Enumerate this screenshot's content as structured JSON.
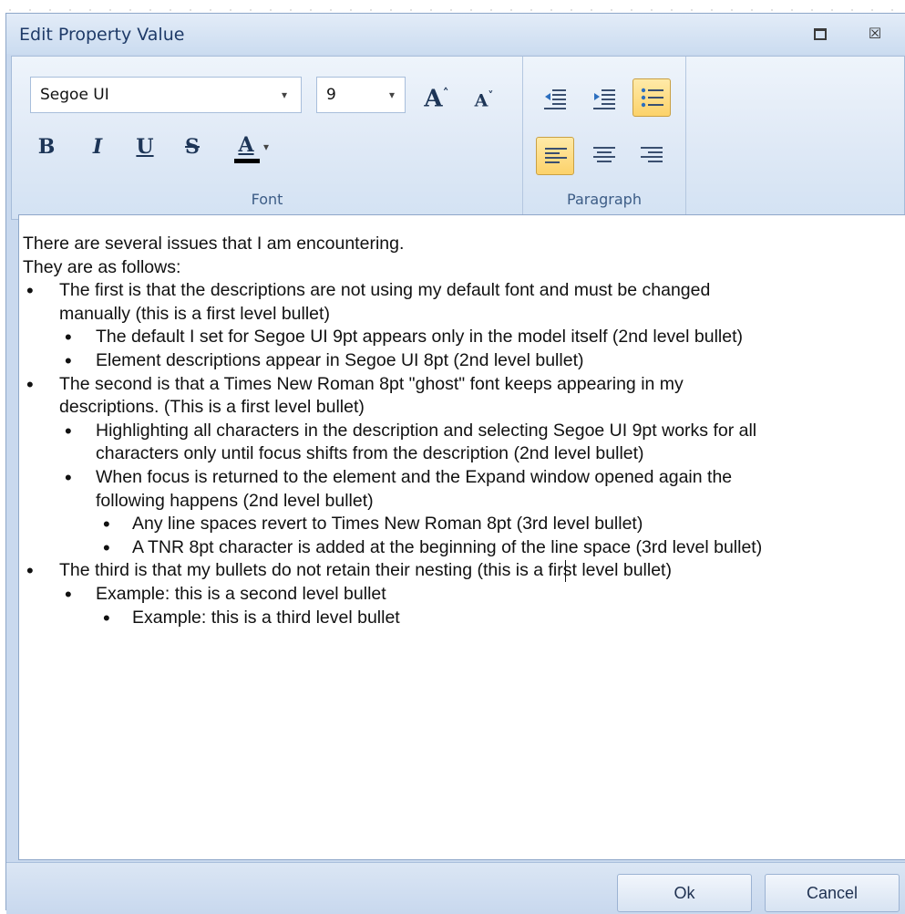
{
  "window": {
    "title": "Edit Property Value",
    "restore_icon": "restore-icon",
    "close_glyph": "☒"
  },
  "ribbon": {
    "font_group": {
      "label": "Font",
      "font_name": "Segoe UI",
      "font_size": "9",
      "dropdown_glyph": "▾",
      "grow_label": "A",
      "grow_mark": "˄",
      "shrink_label": "A",
      "shrink_mark": "˅",
      "bold_label": "B",
      "italic_label": "I",
      "underline_label": "U",
      "strike_label": "S",
      "color_label": "A"
    },
    "paragraph_group": {
      "label": "Paragraph",
      "buttons": [
        {
          "name": "decrease-indent",
          "active": false
        },
        {
          "name": "increase-indent",
          "active": false
        },
        {
          "name": "bullets",
          "active": true
        },
        {
          "name": "align-left",
          "active": true
        },
        {
          "name": "align-center",
          "active": false
        },
        {
          "name": "align-right",
          "active": false
        }
      ]
    }
  },
  "editor": {
    "bullet_glyph": "•",
    "lines": [
      {
        "text": "There are several issues that I am encountering.",
        "level": 0,
        "bullet": false
      },
      {
        "text": "They are as follows:",
        "level": 0,
        "bullet": false
      },
      {
        "text": "The first is that the descriptions are not using my default font and must be changed",
        "level": 1,
        "bullet": true
      },
      {
        "text": "manually (this is a first level bullet)",
        "level": 1,
        "bullet": false
      },
      {
        "text": "The default I set for Segoe UI 9pt appears only in the model itself (2nd level bullet)",
        "level": 2,
        "bullet": true
      },
      {
        "text": "Element descriptions appear in Segoe UI 8pt (2nd level bullet)",
        "level": 2,
        "bullet": true
      },
      {
        "text": "The second is that a Times New Roman 8pt \"ghost\" font keeps appearing in my",
        "level": 1,
        "bullet": true
      },
      {
        "text": "descriptions. (This is a first level bullet)",
        "level": 1,
        "bullet": false
      },
      {
        "text": "Highlighting all characters in the description and selecting Segoe UI 9pt works for all",
        "level": 2,
        "bullet": true
      },
      {
        "text": "characters only until focus shifts from the description (2nd level bullet)",
        "level": 2,
        "bullet": false
      },
      {
        "text": "When focus is returned to the element and the Expand window opened again the",
        "level": 2,
        "bullet": true
      },
      {
        "text": "following happens (2nd level bullet)",
        "level": 2,
        "bullet": false
      },
      {
        "text": "Any line spaces revert to Times New Roman 8pt (3rd level bullet)",
        "level": 3,
        "bullet": true
      },
      {
        "text": "A TNR 8pt character is added at the beginning of the line space (3rd level bullet)",
        "level": 3,
        "bullet": true
      },
      {
        "text": "The third is that my bullets do not retain their nesting (this is a first level bullet)",
        "level": 1,
        "bullet": true
      },
      {
        "text": "Example: this is a second level bullet",
        "level": 2,
        "bullet": true
      },
      {
        "text": "Example: this is a third level bullet",
        "level": 3,
        "bullet": true
      }
    ]
  },
  "footer": {
    "ok_label": "Ok",
    "cancel_label": "Cancel"
  },
  "colors": {
    "dialog_bg": "#c9d9ee",
    "title_text": "#1e3a68",
    "active_button": "#fcd26a"
  }
}
